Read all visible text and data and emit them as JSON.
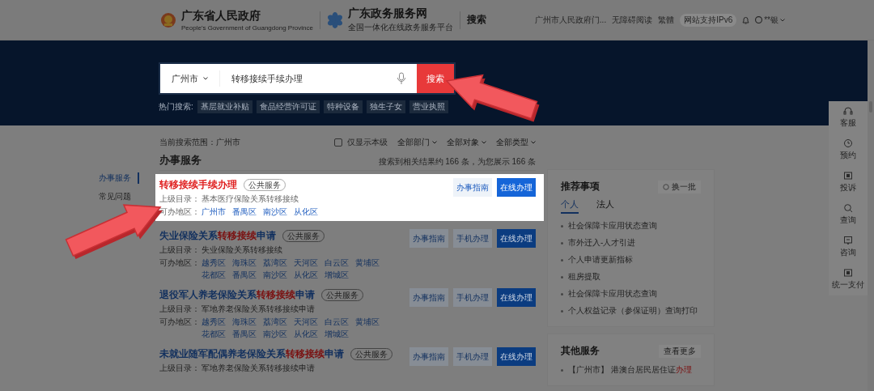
{
  "header": {
    "gov_title": "广东省人民政府",
    "gov_subtitle": "People's Government of Guangdong Province",
    "service_title": "广东政务服务网",
    "service_subtitle": "全国一体化在线政务服务平台",
    "page_title": "搜索",
    "links": [
      "广州市人民政府门...",
      "无障碍阅读",
      "繁體"
    ],
    "ipv6_badge": "网站支持IPv6",
    "user": "**银"
  },
  "search": {
    "region": "广州市",
    "value": "转移接续手续办理",
    "button": "搜索",
    "hot_label": "热门搜索:",
    "hot_tags": [
      "基层就业补贴",
      "食品经营许可证",
      "特种设备",
      "独生子女",
      "营业执照"
    ]
  },
  "filter": {
    "scope_label": "当前搜索范围：",
    "scope": "广州市",
    "only_level": {
      "label": "仅显示本级",
      "checked": false
    },
    "dropdowns": [
      "全部部门",
      "全部对象",
      "全部类型"
    ]
  },
  "sidebar": {
    "items": [
      {
        "label": "办事服务",
        "selected": true
      },
      {
        "label": "常见问题",
        "selected": false
      }
    ]
  },
  "results": {
    "title": "办事服务",
    "count": "搜索到相关结果约 166 条，为您展示 166 条",
    "items": [
      {
        "focused": true,
        "title": [
          {
            "text": "转移接续手续办理",
            "match": true
          }
        ],
        "tag": "公共服务",
        "parent_label": "上级目录：",
        "parent": "基本医疗保险关系转移接续",
        "area_label": "可办地区：",
        "areas": [
          "广州市",
          "番禺区",
          "南沙区",
          "从化区"
        ],
        "buttons": [
          {
            "label": "办事指南",
            "kind": "guide"
          },
          {
            "label": "在线办理",
            "kind": "online"
          }
        ]
      },
      {
        "focused": false,
        "title": [
          {
            "text": "失业保险关系",
            "match": false
          },
          {
            "text": "转移接续",
            "match": true
          },
          {
            "text": "申请",
            "match": false
          }
        ],
        "tag": "公共服务",
        "parent_label": "上级目录：",
        "parent": "失业保险关系转移接续",
        "area_label": "可办地区：",
        "areas": [
          "越秀区",
          "海珠区",
          "荔湾区",
          "天河区",
          "白云区",
          "黄埔区",
          "花都区",
          "番禺区",
          "南沙区",
          "从化区",
          "增城区"
        ],
        "buttons": [
          {
            "label": "办事指南",
            "kind": "guide"
          },
          {
            "label": "手机办理",
            "kind": "mobile"
          },
          {
            "label": "在线办理",
            "kind": "online"
          }
        ]
      },
      {
        "focused": false,
        "title": [
          {
            "text": "退役军人养老保险关系",
            "match": false
          },
          {
            "text": "转移接续",
            "match": true
          },
          {
            "text": "申请",
            "match": false
          }
        ],
        "tag": "公共服务",
        "parent_label": "上级目录：",
        "parent": "军地养老保险关系转移接续申请",
        "area_label": "可办地区：",
        "areas": [
          "越秀区",
          "海珠区",
          "荔湾区",
          "天河区",
          "白云区",
          "黄埔区",
          "花都区",
          "番禺区",
          "南沙区",
          "从化区",
          "增城区"
        ],
        "buttons": [
          {
            "label": "办事指南",
            "kind": "guide"
          },
          {
            "label": "手机办理",
            "kind": "mobile"
          },
          {
            "label": "在线办理",
            "kind": "online"
          }
        ]
      },
      {
        "focused": false,
        "title": [
          {
            "text": "未就业随军配偶养老保险关系",
            "match": false
          },
          {
            "text": "转移接续",
            "match": true
          },
          {
            "text": "申请",
            "match": false
          }
        ],
        "tag": "公共服务",
        "parent_label": "上级目录：",
        "parent": "军地养老保险关系转移接续申请",
        "buttons": [
          {
            "label": "办事指南",
            "kind": "guide"
          },
          {
            "label": "手机办理",
            "kind": "mobile"
          },
          {
            "label": "在线办理",
            "kind": "online"
          }
        ]
      }
    ]
  },
  "recommend": {
    "title": "推荐事项",
    "refresh": "换一批",
    "tabs": [
      {
        "label": "个人",
        "selected": true
      },
      {
        "label": "法人",
        "selected": false
      }
    ],
    "items": [
      "社会保障卡应用状态查询",
      "市外迁入-人才引进",
      "个人申请更新指标",
      "租房提取",
      "社会保障卡应用状态查询",
      "个人权益记录（参保证明）查询打印"
    ]
  },
  "other": {
    "title": "其他服务",
    "more": "查看更多",
    "items": [
      [
        {
          "text": "【广州市】 港澳台居民居住证",
          "match": false
        },
        {
          "text": "办理",
          "match": true
        }
      ]
    ]
  },
  "toolbar": [
    {
      "label": "客服",
      "kind": "headset"
    },
    {
      "label": "预约",
      "kind": "clock"
    },
    {
      "label": "投诉",
      "kind": "box"
    },
    {
      "label": "查询",
      "kind": "search"
    },
    {
      "label": "咨询",
      "kind": "chat"
    },
    {
      "label": "统一支付",
      "kind": "box"
    }
  ],
  "annotations": [
    {
      "kind": "arrow"
    },
    {
      "kind": "arrow"
    }
  ]
}
